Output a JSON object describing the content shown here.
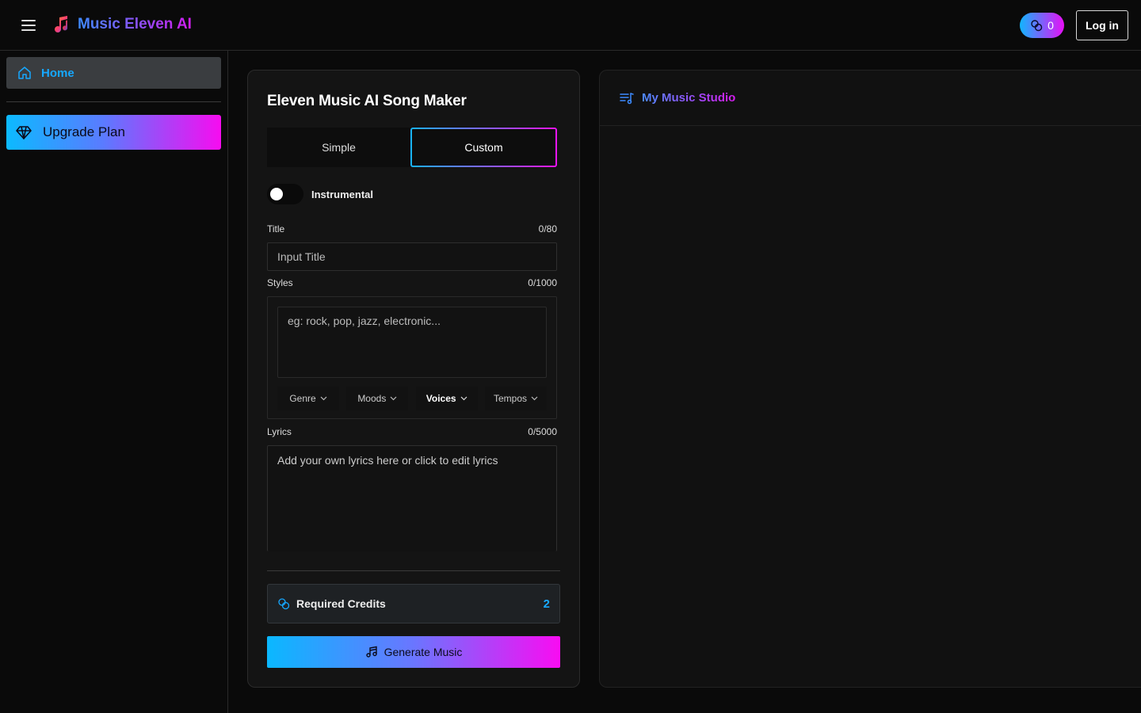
{
  "header": {
    "app_name": "Music Eleven AI",
    "credits_count": "0",
    "login_label": "Log in"
  },
  "sidebar": {
    "home_label": "Home",
    "upgrade_label": "Upgrade Plan"
  },
  "maker": {
    "title": "Eleven Music AI Song Maker",
    "tabs": [
      {
        "label": "Simple",
        "active": false
      },
      {
        "label": "Custom",
        "active": true
      }
    ],
    "instrumental_label": "Instrumental",
    "instrumental_on": false,
    "title_field": {
      "label": "Title",
      "count": "0/80",
      "placeholder": "Input Title",
      "value": ""
    },
    "styles_field": {
      "label": "Styles",
      "count": "0/1000",
      "placeholder": "eg: rock, pop, jazz, electronic...",
      "value": ""
    },
    "style_options": [
      "Genre",
      "Moods",
      "Voices",
      "Tempos"
    ],
    "lyrics_field": {
      "label": "Lyrics",
      "count": "0/5000",
      "placeholder": "Add your own lyrics here or click to edit lyrics",
      "value": ""
    },
    "required_credits_label": "Required Credits",
    "required_credits_value": "2",
    "generate_label": "Generate Music"
  },
  "studio": {
    "title": "My Music Studio"
  },
  "colors": {
    "accent_blue": "#16a8ff",
    "accent_magenta": "#f00cf2",
    "background": "#0a0a0a",
    "panel": "#141414"
  },
  "icons": {
    "menu": "hamburger-icon",
    "logo": "music-note-logo-icon",
    "credits": "coins-icon",
    "home": "home-icon",
    "upgrade": "diamond-icon",
    "dropdown": "chevron-down-icon",
    "generate": "music-note-icon",
    "studio": "playlist-icon"
  }
}
